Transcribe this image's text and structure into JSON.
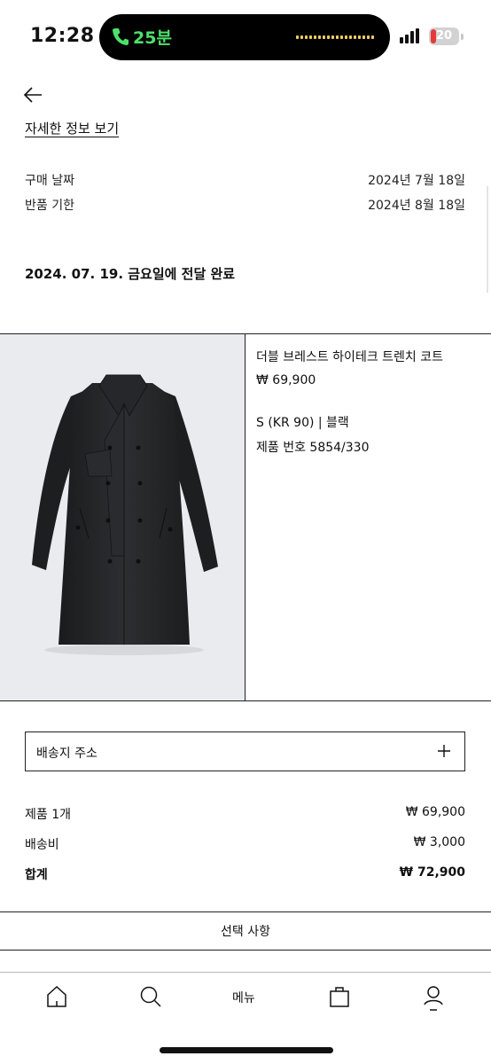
{
  "status_bar": {
    "time": "12:28",
    "call_duration": "25분",
    "battery_level": "20",
    "battery_fraction": 0.2
  },
  "header": {
    "details_link": "자세한 정보 보기"
  },
  "order_info": [
    {
      "label": "구매 날짜",
      "value": "2024년 7월 18일"
    },
    {
      "label": "반품 기한",
      "value": "2024년 8월 18일"
    }
  ],
  "delivery_status": "2024. 07. 19. 금요일에 전달 완료",
  "product": {
    "name": "더블 브레스트 하이테크 트렌치 코트",
    "price": "₩ 69,900",
    "variant": "S (KR 90) | 블랙",
    "code": "제품 번호 5854/330",
    "image": "black-trench-coat"
  },
  "address": {
    "label": "배송지 주소"
  },
  "summary": [
    {
      "label": "제품 1개",
      "value": "₩ 69,900"
    },
    {
      "label": "배송비",
      "value": "₩ 3,000"
    },
    {
      "label": "합계",
      "value": "₩ 72,900"
    }
  ],
  "options_label": "선택 사항",
  "bottom_nav": {
    "menu_label": "메뉴",
    "icons": [
      "home-icon",
      "search-icon",
      "shopping-bag-icon",
      "user-icon"
    ]
  },
  "colors": {
    "call_green": "#4ee06a",
    "battery_red": "#e5393a",
    "product_bg": "#e9ebef"
  }
}
